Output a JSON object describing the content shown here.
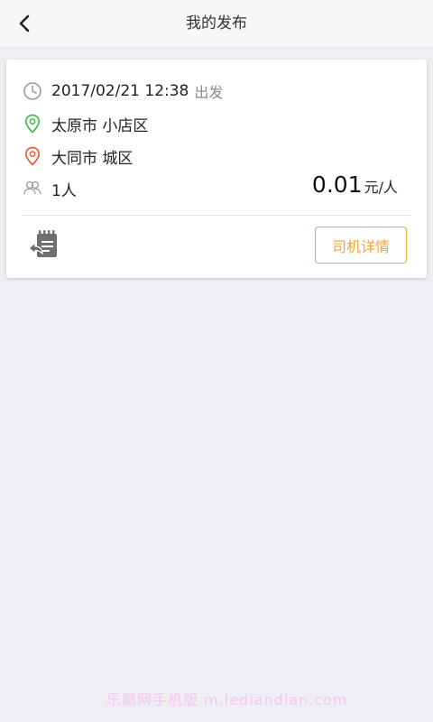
{
  "header": {
    "title": "我的发布"
  },
  "trip": {
    "datetime": "2017/02/21 12:38",
    "departure_suffix": "出发",
    "origin": "太原市 小店区",
    "destination": "大同市 城区",
    "passengers": "1人",
    "price": "0.01",
    "price_unit": "元/人"
  },
  "actions": {
    "driver_details_label": "司机详情"
  },
  "icons": {
    "back": "chevron-left-icon",
    "clock": "clock-icon",
    "origin": "location-pin-green-icon",
    "destination": "location-pin-red-icon",
    "people": "people-icon",
    "republish": "republish-note-icon"
  },
  "colors": {
    "accent": "#f0a43a",
    "origin_pin": "#3dbb4c",
    "destination_pin": "#ef5a3c",
    "background": "#efeef3"
  },
  "watermark": "乐颠网手机版 m.lediandian.com"
}
